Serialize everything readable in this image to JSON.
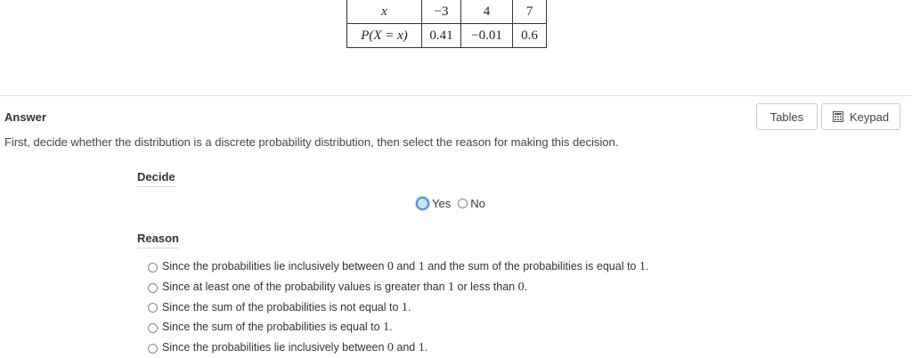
{
  "table": {
    "header_row": [
      "x",
      "−3",
      "4",
      "7"
    ],
    "prob_row": [
      "P(X = x)",
      "0.41",
      "−0.01",
      "0.6"
    ]
  },
  "answer": {
    "heading": "Answer",
    "instructions": "First, decide whether the distribution is a discrete probability distribution, then select the reason for making this decision."
  },
  "tools": {
    "tables_label": "Tables",
    "keypad_label": "Keypad",
    "keypad_icon": "calculator-icon"
  },
  "decide": {
    "label": "Decide",
    "options": [
      {
        "label": "Yes",
        "selected": true
      },
      {
        "label": "No",
        "selected": false
      }
    ]
  },
  "reason": {
    "label": "Reason",
    "options": [
      {
        "parts": [
          "Since the probabilities lie inclusively between ",
          "0",
          " and ",
          "1",
          " and the sum of the probabilities is equal to ",
          "1",
          "."
        ]
      },
      {
        "parts": [
          "Since at least one of the probability values is greater than ",
          "1",
          " or less than ",
          "0",
          "."
        ]
      },
      {
        "parts": [
          "Since the sum of the probabilities is not equal to ",
          "1",
          "."
        ]
      },
      {
        "parts": [
          "Since the sum of the probabilities is equal to ",
          "1",
          "."
        ]
      },
      {
        "parts": [
          "Since the probabilities lie inclusively between ",
          "0",
          " and ",
          "1",
          "."
        ]
      }
    ]
  }
}
